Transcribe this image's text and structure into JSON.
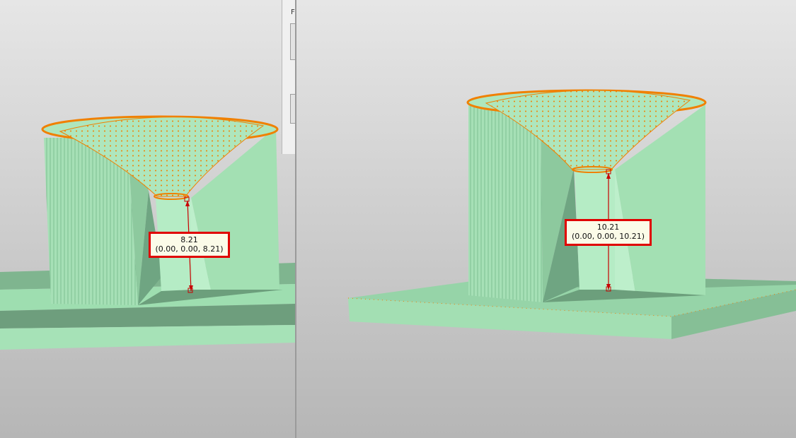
{
  "viewports": [
    {
      "id": "left",
      "measurement": {
        "distance": "8.21",
        "vector": "(0.00, 0.00, 8.21)"
      }
    },
    {
      "id": "right",
      "measurement": {
        "distance": "10.21",
        "vector": "(0.00, 0.00, 10.21)"
      }
    }
  ],
  "dock": {
    "tab_glyph": "F"
  },
  "colors": {
    "model_fill": "#9edeb0",
    "model_light": "#b4ecc4",
    "model_dark": "#6c9f7c",
    "edge": "#f08000",
    "measure_line": "#c80000",
    "label_border": "#e00000",
    "background_top": "#e4e4e4",
    "background_bottom": "#b8b8b8"
  }
}
